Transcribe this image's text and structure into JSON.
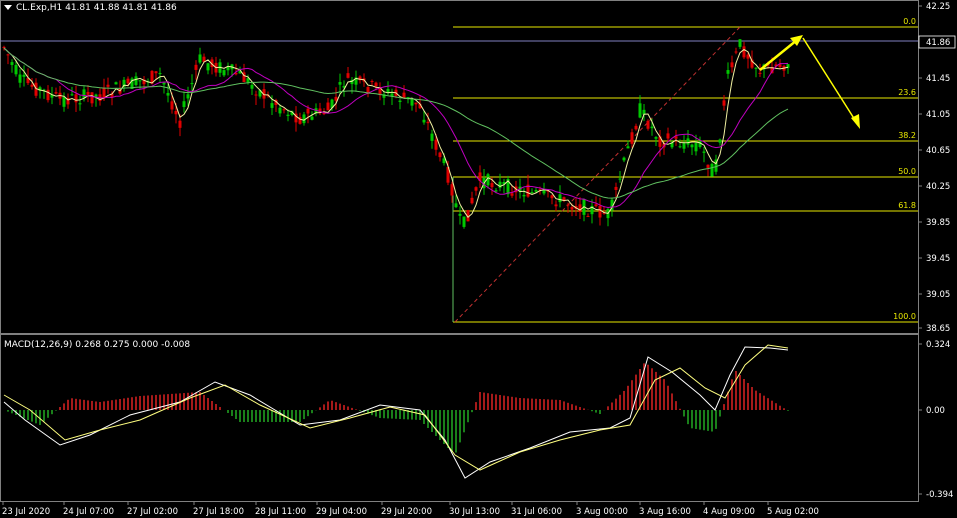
{
  "header": {
    "symbol_line": "CL.Exp,H1  41.81 41.88 41.81 41.86"
  },
  "macd": {
    "title": "MACD(12,26,9) 0.268 0.275 0.000 -0.008",
    "axis_labels": [
      "0.324",
      "0.00",
      "-0.394"
    ]
  },
  "price_axis": {
    "labels": [
      "42.25",
      "41.86",
      "41.45",
      "41.05",
      "40.65",
      "40.25",
      "39.85",
      "39.45",
      "39.05",
      "38.65"
    ]
  },
  "time_axis": {
    "labels": [
      "23 Jul 2020",
      "24 Jul 07:00",
      "27 Jul 02:00",
      "27 Jul 18:00",
      "28 Jul 11:00",
      "29 Jul 04:00",
      "29 Jul 20:00",
      "30 Jul 13:00",
      "31 Jul 06:00",
      "3 Aug 00:00",
      "3 Aug 16:00",
      "4 Aug 09:00",
      "5 Aug 02:00"
    ]
  },
  "fibonacci": {
    "levels": [
      "0.0",
      "23.6",
      "38.2",
      "50.0",
      "61.8",
      "100.0"
    ]
  },
  "colors": {
    "background": "#000000",
    "bull_candle": "#00c800",
    "bear_candle": "#e00000",
    "fib_line": "#e8e800",
    "current_price_line": "#8080c0",
    "arrow": "#ffff00",
    "ma_fast": "#f0f0a0",
    "ma_mid": "#c000c0",
    "ma_slow": "#60c060",
    "macd_main": "#ffffff",
    "macd_signal": "#ffff80"
  },
  "icons": {
    "menu": "dropdown-triangle-icon"
  }
}
